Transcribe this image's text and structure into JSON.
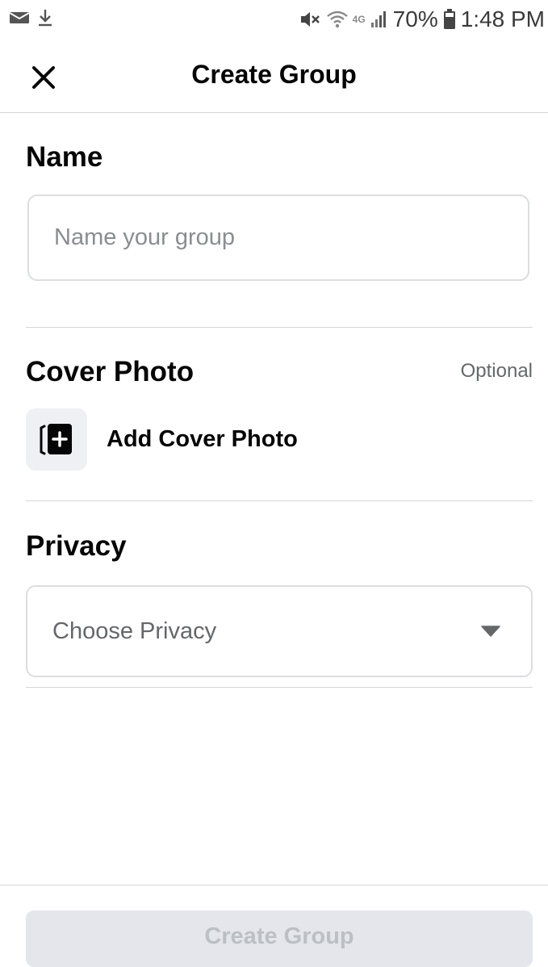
{
  "status_bar": {
    "icons_left": [
      "email-icon",
      "download-icon"
    ],
    "icons_right": [
      "mute-icon",
      "wifi-icon",
      "signal-icon",
      "battery-icon"
    ],
    "network_type": "4G",
    "battery": "70%",
    "time": "1:48 PM"
  },
  "header": {
    "close_icon": "close-icon",
    "title": "Create Group"
  },
  "name_section": {
    "title": "Name",
    "placeholder": "Name your group",
    "value": ""
  },
  "cover_section": {
    "title": "Cover Photo",
    "optional_label": "Optional",
    "add_label": "Add Cover Photo",
    "icon": "add-photo-icon"
  },
  "privacy_section": {
    "title": "Privacy",
    "selected": "Choose Privacy",
    "icon": "caret-down-icon"
  },
  "footer": {
    "create_label": "Create Group",
    "enabled": false
  },
  "colors": {
    "text_primary": "#050505",
    "text_secondary": "#65676b",
    "border": "#dcdde1",
    "disabled_button_bg": "#e4e6eb",
    "disabled_button_text": "#bcc0c4"
  }
}
